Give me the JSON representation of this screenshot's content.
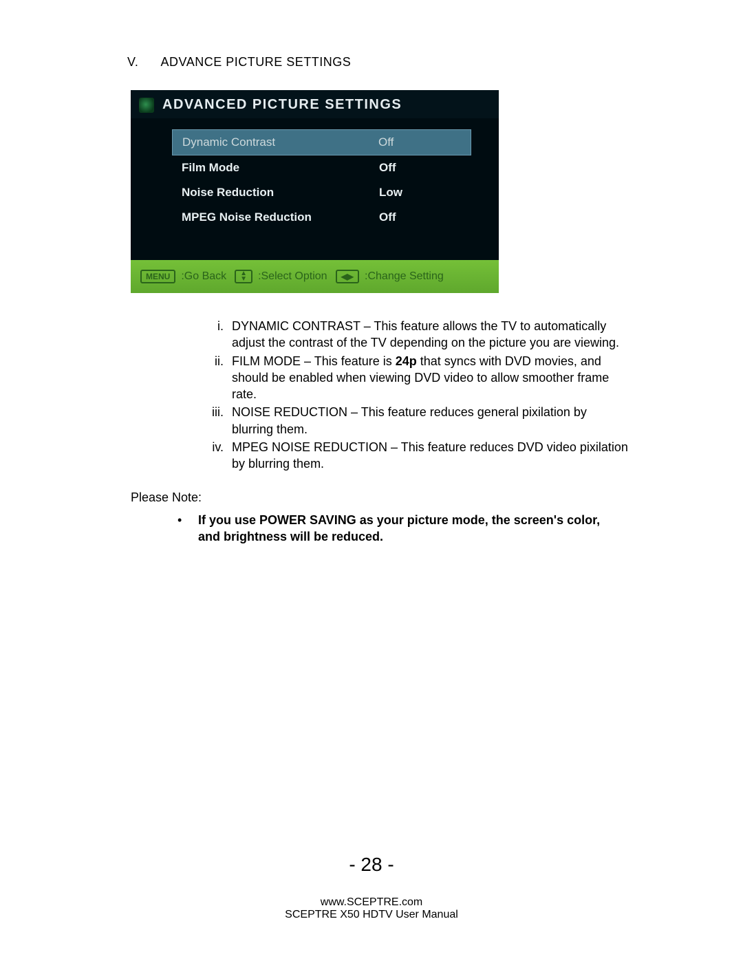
{
  "section": {
    "number": "V.",
    "title": "ADVANCE PICTURE SETTINGS"
  },
  "osd": {
    "title": "ADVANCED PICTURE SETTINGS",
    "rows": [
      {
        "label": "Dynamic Contrast",
        "value": "Off",
        "selected": true
      },
      {
        "label": "Film Mode",
        "value": "Off",
        "selected": false
      },
      {
        "label": "Noise Reduction",
        "value": "Low",
        "selected": false
      },
      {
        "label": "MPEG Noise Reduction",
        "value": "Off",
        "selected": false
      }
    ],
    "footer": {
      "menu_key": "MENU",
      "go_back": ":Go Back",
      "select_option": ":Select Option",
      "change_setting": ":Change Setting"
    }
  },
  "explanations": [
    {
      "num": "i.",
      "term": "DYNAMIC CONTRAST",
      "text": " – This feature allows the TV to automatically adjust the contrast of the TV depending on the picture you are viewing."
    },
    {
      "num": "ii.",
      "term": "FILM MODE",
      "text_before": " – This feature is ",
      "bold": "24p",
      "text_after": " that syncs with DVD movies, and should be enabled when viewing DVD video to allow smoother frame rate."
    },
    {
      "num": "iii.",
      "term": "NOISE REDUCTION",
      "text": " – This feature reduces general pixilation by blurring them."
    },
    {
      "num": "iv.",
      "term": "MPEG NOISE REDUCTION",
      "text": " – This feature reduces DVD video pixilation by blurring them."
    }
  ],
  "please_note_label": "Please Note:",
  "notes": [
    "If you use POWER SAVING as your picture mode, the screen's color, and brightness will be reduced."
  ],
  "page_number": "- 28 -",
  "footer_lines": [
    "www.SCEPTRE.com",
    "SCEPTRE X50 HDTV User Manual"
  ]
}
